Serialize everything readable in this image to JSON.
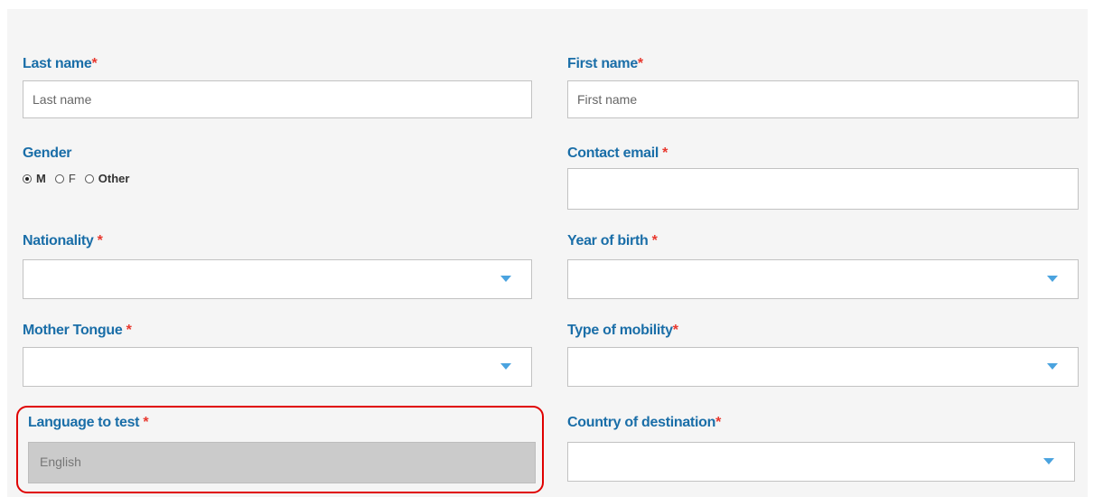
{
  "form": {
    "last_name": {
      "label": "Last name",
      "required_mark": "*",
      "placeholder": "Last name",
      "value": ""
    },
    "first_name": {
      "label": "First name",
      "required_mark": "*",
      "placeholder": "First name",
      "value": ""
    },
    "gender": {
      "label": "Gender",
      "options": [
        {
          "label": "M",
          "checked": true
        },
        {
          "label": "F",
          "checked": false
        },
        {
          "label": "Other",
          "checked": false
        }
      ]
    },
    "contact_email": {
      "label": "Contact email ",
      "required_mark": "*",
      "value": ""
    },
    "nationality": {
      "label": "Nationality ",
      "required_mark": "*",
      "selected": ""
    },
    "year_of_birth": {
      "label": "Year of birth ",
      "required_mark": "*",
      "selected": ""
    },
    "mother_tongue": {
      "label": "Mother Tongue ",
      "required_mark": "*",
      "selected": ""
    },
    "type_of_mobility": {
      "label": "Type of mobility",
      "required_mark": "*",
      "selected": ""
    },
    "language_to_test": {
      "label": "Language to test ",
      "required_mark": "*",
      "value": "English",
      "disabled": true
    },
    "country_of_destination": {
      "label": "Country of destination",
      "required_mark": "*",
      "selected": ""
    }
  },
  "colors": {
    "label": "#1a6ea8",
    "required": "#e8382e",
    "caret": "#4aa3df",
    "highlight": "#e00000",
    "disabled_field": "#cbcbcb"
  },
  "icons": {
    "dropdown": "caret-down-icon",
    "radio": "radio-icon"
  }
}
